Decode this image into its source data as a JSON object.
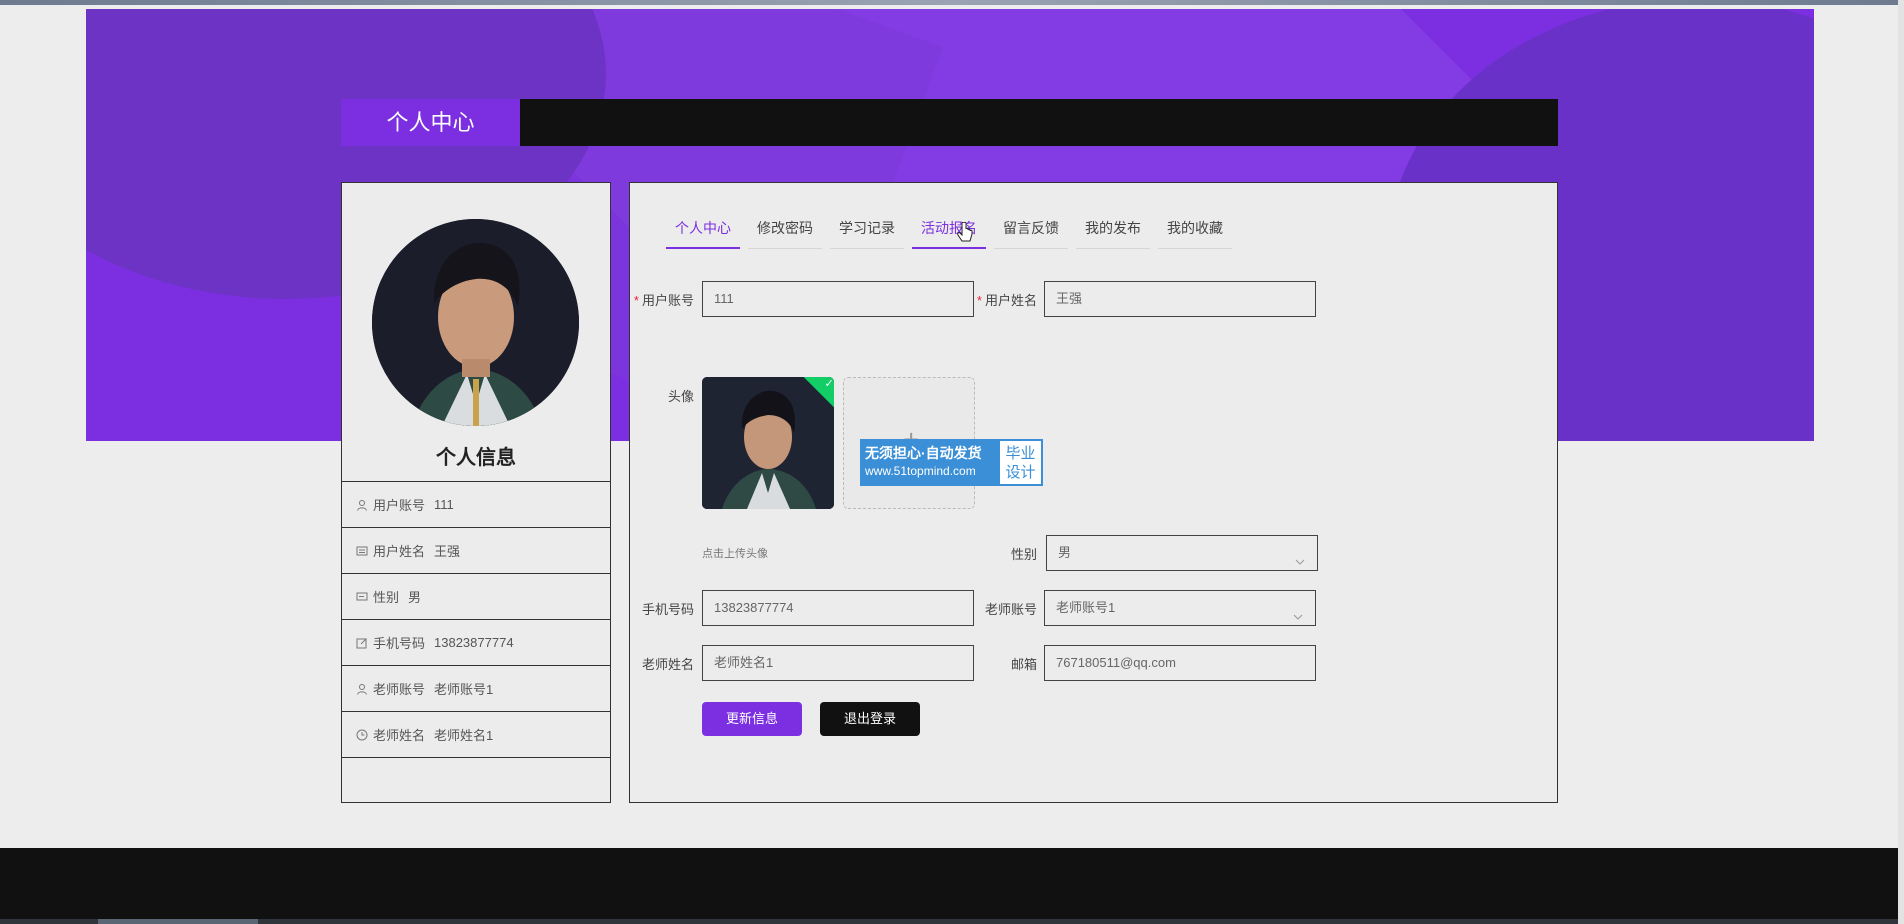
{
  "page": {
    "title": "个人中心"
  },
  "profile_card": {
    "heading": "个人信息",
    "rows": [
      {
        "icon": "user-icon",
        "label": "用户账号",
        "value": "111"
      },
      {
        "icon": "card-icon",
        "label": "用户姓名",
        "value": "王强"
      },
      {
        "icon": "message-icon",
        "label": "性别",
        "value": "男"
      },
      {
        "icon": "edit-icon",
        "label": "手机号码",
        "value": "13823877774"
      },
      {
        "icon": "teacher-icon",
        "label": "老师账号",
        "value": "老师账号1"
      },
      {
        "icon": "clock-icon",
        "label": "老师姓名",
        "value": "老师姓名1"
      }
    ]
  },
  "tabs": [
    {
      "label": "个人中心",
      "active": true
    },
    {
      "label": "修改密码"
    },
    {
      "label": "学习记录"
    },
    {
      "label": "活动报名",
      "hover": true
    },
    {
      "label": "留言反馈"
    },
    {
      "label": "我的发布"
    },
    {
      "label": "我的收藏"
    }
  ],
  "form": {
    "account_label": "用户账号",
    "account_value": "111",
    "name_label": "用户姓名",
    "name_value": "王强",
    "avatar_label": "头像",
    "upload_tip": "点击上传头像",
    "gender_label": "性别",
    "gender_value": "男",
    "phone_label": "手机号码",
    "phone_value": "13823877774",
    "teacher_account_label": "老师账号",
    "teacher_account_value": "老师账号1",
    "teacher_name_label": "老师姓名",
    "teacher_name_value": "老师姓名1",
    "email_label": "邮箱",
    "email_value": "767180511@qq.com",
    "update_button": "更新信息",
    "logout_button": "退出登录"
  },
  "watermark": {
    "line1": "无须担心·自动发货",
    "line2": "www.51topmind.com",
    "side1": "毕业",
    "side2": "设计"
  },
  "colors": {
    "accent": "#7b2fe0",
    "dark": "#111111",
    "background": "#ededed"
  }
}
